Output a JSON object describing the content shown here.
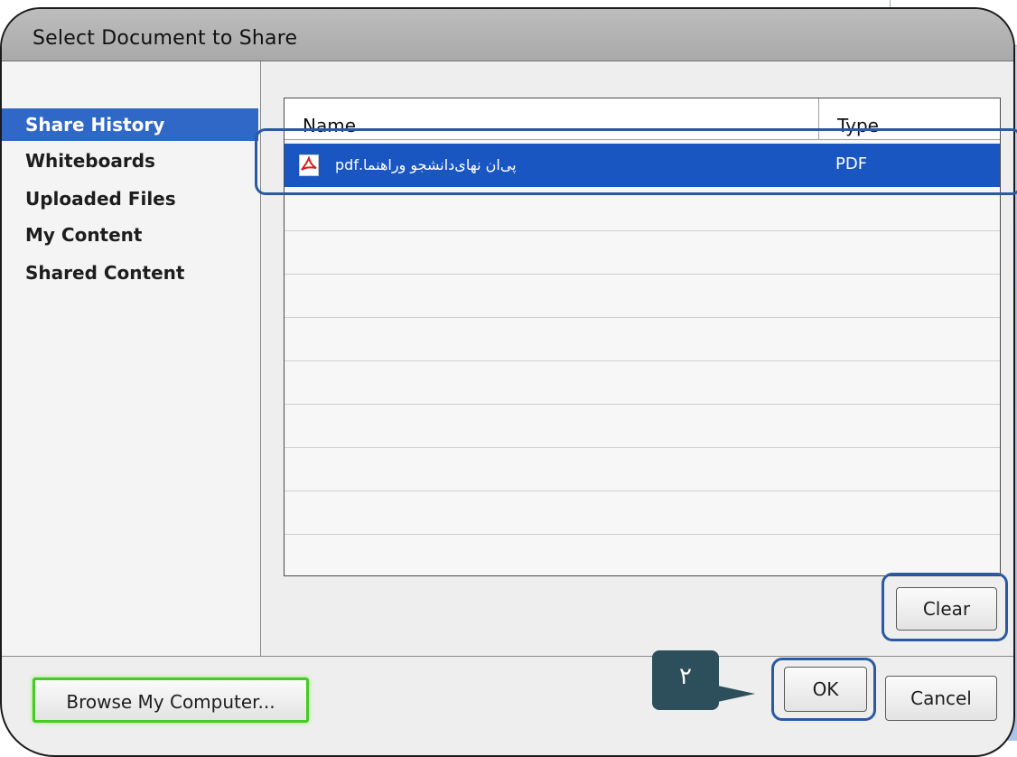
{
  "dialog": {
    "title": "Select Document to Share"
  },
  "sidebar": {
    "items": [
      {
        "label": "Share History",
        "selected": true
      },
      {
        "label": "Whiteboards",
        "selected": false
      },
      {
        "label": "Uploaded Files",
        "selected": false
      },
      {
        "label": "My Content",
        "selected": false
      },
      {
        "label": "Shared Content",
        "selected": false
      }
    ]
  },
  "table": {
    "columns": [
      "Name",
      "Type"
    ],
    "rows": [
      {
        "name": "پی‌ان نهای‌دانشجو وراهنما.pdf",
        "type": "PDF",
        "icon": "pdf-icon",
        "selected": true
      }
    ]
  },
  "buttons": {
    "clear": "Clear",
    "browse": "Browse My Computer...",
    "ok": "OK",
    "cancel": "Cancel"
  },
  "callout": {
    "step": "٢"
  },
  "colors": {
    "selection": "#1a56c2",
    "nav_selected": "#2f68c6",
    "highlight_border": "#2a5aa4",
    "browse_glow": "#44cc22",
    "callout_bg": "#2d4f5c"
  }
}
